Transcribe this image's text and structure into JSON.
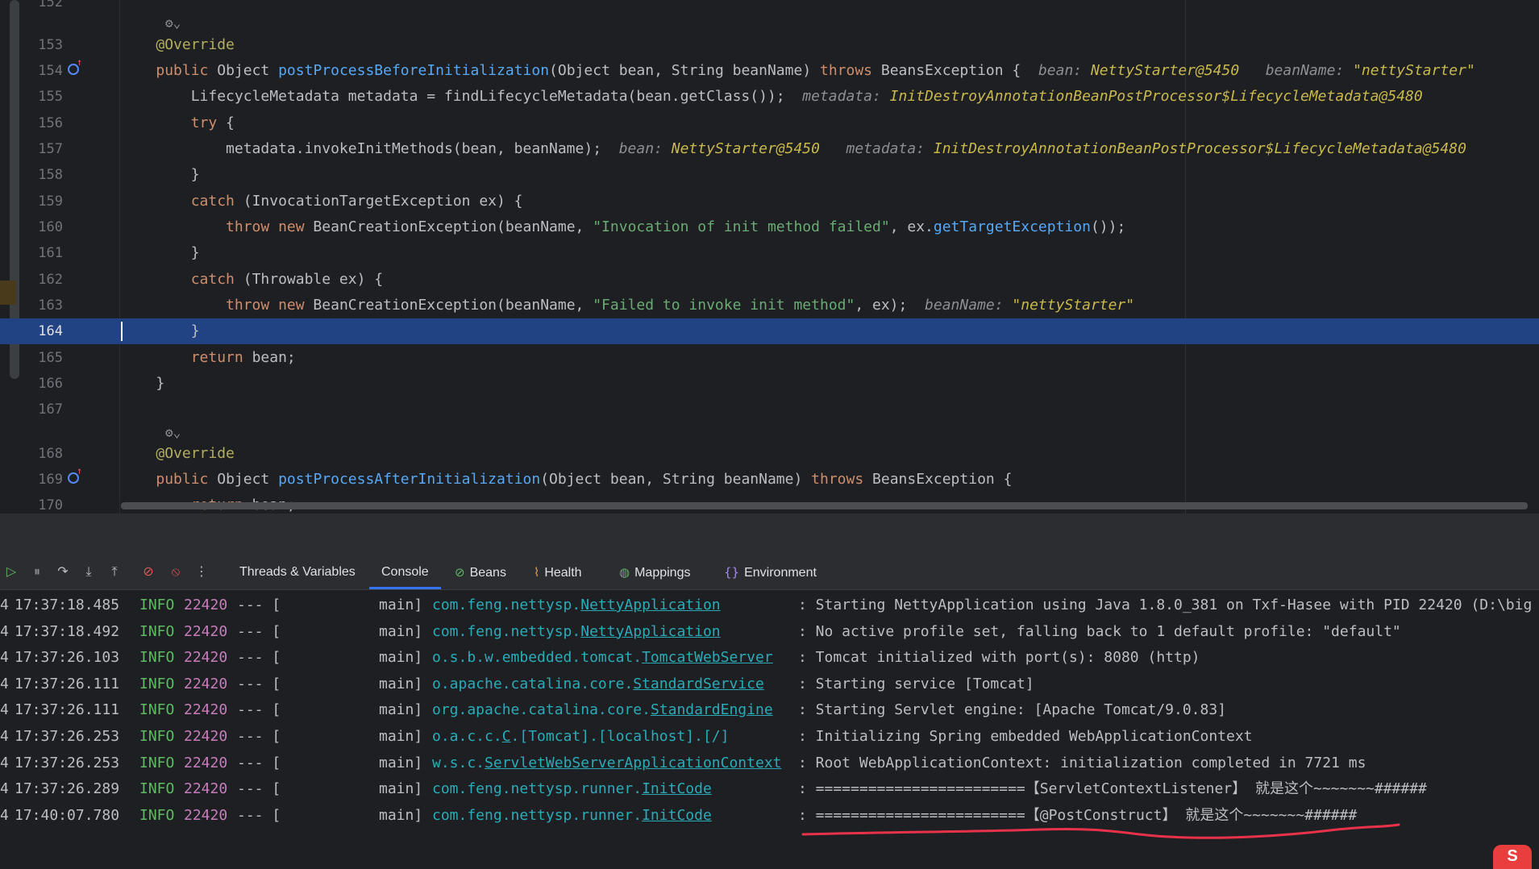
{
  "editor": {
    "lines": [
      {
        "num": "152"
      },
      {
        "num": "153",
        "html": "<span class='a'>@Override</span>"
      },
      {
        "num": "154",
        "html": "<span class='k'>public</span> Object <span class='m'>postProcessBeforeInitialization</span>(Object bean, String beanName) <span class='k'>throws</span> BeansException {  <span class='hv-l'>bean: </span><span class='hv-v'>NettyStarter@5450</span>   <span class='hv-l'>beanName: </span><span class='hv-v'>\"nettyStarter\"</span>"
      },
      {
        "num": "155",
        "html": "    LifecycleMetadata metadata = findLifecycleMetadata(bean.getClass());  <span class='hv-l'>metadata: </span><span class='hv-v'>InitDestroyAnnotationBeanPostProcessor$LifecycleMetadata@5480</span>"
      },
      {
        "num": "156",
        "html": "    <span class='k'>try</span> {"
      },
      {
        "num": "157",
        "html": "        metadata.invokeInitMethods(bean, beanName);  <span class='hv-l'>bean: </span><span class='hv-v'>NettyStarter@5450</span>   <span class='hv-l'>metadata: </span><span class='hv-v'>InitDestroyAnnotationBeanPostProcessor$LifecycleMetadata@5480</span>"
      },
      {
        "num": "158",
        "html": "    }"
      },
      {
        "num": "159",
        "html": "    <span class='k'>catch</span> (InvocationTargetException ex) {"
      },
      {
        "num": "160",
        "html": "        <span class='k'>throw new</span> BeanCreationException(beanName, <span class='s'>\"Invocation of init method failed\"</span>, ex.<span class='m'>getTargetException</span>());"
      },
      {
        "num": "161",
        "html": "    }"
      },
      {
        "num": "162",
        "html": "    <span class='k'>catch</span> (Throwable ex) {"
      },
      {
        "num": "163",
        "html": "        <span class='k'>throw new</span> BeanCreationException(beanName, <span class='s'>\"Failed to invoke init method\"</span>, ex);  <span class='hv-l'>beanName: </span><span class='hv-v'>\"nettyStarter\"</span>"
      },
      {
        "num": "164",
        "html": "    }"
      },
      {
        "num": "165",
        "html": "    <span class='k'>return</span> bean;"
      },
      {
        "num": "166",
        "html": "}"
      },
      {
        "num": "167"
      },
      {
        "num": "168",
        "html": "<span class='a'>@Override</span>"
      },
      {
        "num": "169",
        "html": "<span class='k'>public</span> Object <span class='m'>postProcessAfterInitialization</span>(Object bean, String beanName) <span class='k'>throws</span> BeansException {"
      },
      {
        "num": "170",
        "html": "    <span class='k'>return</span> bean;"
      }
    ]
  },
  "toolbar": {
    "tabs": [
      {
        "label": "Threads & Variables",
        "icon": ""
      },
      {
        "label": "Console",
        "icon": "",
        "active": true
      },
      {
        "label": "Beans",
        "icon": "⊘"
      },
      {
        "label": "Health",
        "icon": "⌇"
      },
      {
        "label": "Mappings",
        "icon": "◍"
      },
      {
        "label": "Environment",
        "icon": "{}"
      }
    ]
  },
  "console": {
    "rows": [
      {
        "prefix": "4",
        "time": "17:37:18.485",
        "level": "INFO",
        "pid": "22420",
        "sep": "--- [",
        "thread": "main]",
        "logger_pre": "com.feng.nettysp.",
        "logger_cls": "NettyApplication",
        "msg": ": Starting NettyApplication using Java 1.8.0_381 on Txf-Hasee with PID 22420 (D:\\big"
      },
      {
        "prefix": "4",
        "time": "17:37:18.492",
        "level": "INFO",
        "pid": "22420",
        "sep": "--- [",
        "thread": "main]",
        "logger_pre": "com.feng.nettysp.",
        "logger_cls": "NettyApplication",
        "msg": ": No active profile set, falling back to 1 default profile: \"default\""
      },
      {
        "prefix": "4",
        "time": "17:37:26.103",
        "level": "INFO",
        "pid": "22420",
        "sep": "--- [",
        "thread": "main]",
        "logger_pre": "o.s.b.w.embedded.tomcat.",
        "logger_cls": "TomcatWebServer",
        "msg": ": Tomcat initialized with port(s): 8080 (http)"
      },
      {
        "prefix": "4",
        "time": "17:37:26.111",
        "level": "INFO",
        "pid": "22420",
        "sep": "--- [",
        "thread": "main]",
        "logger_pre": "o.apache.catalina.core.",
        "logger_cls": "StandardService",
        "msg": ": Starting service [Tomcat]"
      },
      {
        "prefix": "4",
        "time": "17:37:26.111",
        "level": "INFO",
        "pid": "22420",
        "sep": "--- [",
        "thread": "main]",
        "logger_pre": "org.apache.catalina.core.",
        "logger_cls": "StandardEngine",
        "msg": ": Starting Servlet engine: [Apache Tomcat/9.0.83]"
      },
      {
        "prefix": "4",
        "time": "17:37:26.253",
        "level": "INFO",
        "pid": "22420",
        "sep": "--- [",
        "thread": "main]",
        "logger_pre": "o.a.c.c.",
        "logger_cls": "C",
        "logger_post": ".[Tomcat].[localhost].[/]",
        "msg": ": Initializing Spring embedded WebApplicationContext"
      },
      {
        "prefix": "4",
        "time": "17:37:26.253",
        "level": "INFO",
        "pid": "22420",
        "sep": "--- [",
        "thread": "main]",
        "logger_pre": "w.s.c.",
        "logger_cls": "ServletWebServerApplicationContext",
        "msg": ": Root WebApplicationContext: initialization completed in 7721 ms"
      },
      {
        "prefix": "4",
        "time": "17:37:26.289",
        "level": "INFO",
        "pid": "22420",
        "sep": "--- [",
        "thread": "main]",
        "logger_pre": "com.feng.nettysp.runner.",
        "logger_cls": "InitCode",
        "msg": ": ========================【ServletContextListener】 就是这个~~~~~~~######"
      },
      {
        "prefix": "4",
        "time": "17:40:07.780",
        "level": "INFO",
        "pid": "22420",
        "sep": "--- [",
        "thread": "main]",
        "logger_pre": "com.feng.nettysp.runner.",
        "logger_cls": "InitCode",
        "msg": ": ========================【@PostConstruct】 就是这个~~~~~~~######"
      }
    ]
  },
  "badge": {
    "label": "S"
  },
  "colors": {
    "highlight": "#214283",
    "keyword": "#cf8e6d",
    "method": "#56a8f5",
    "string": "#6aab73",
    "annotation_underline": "#e8324a"
  }
}
